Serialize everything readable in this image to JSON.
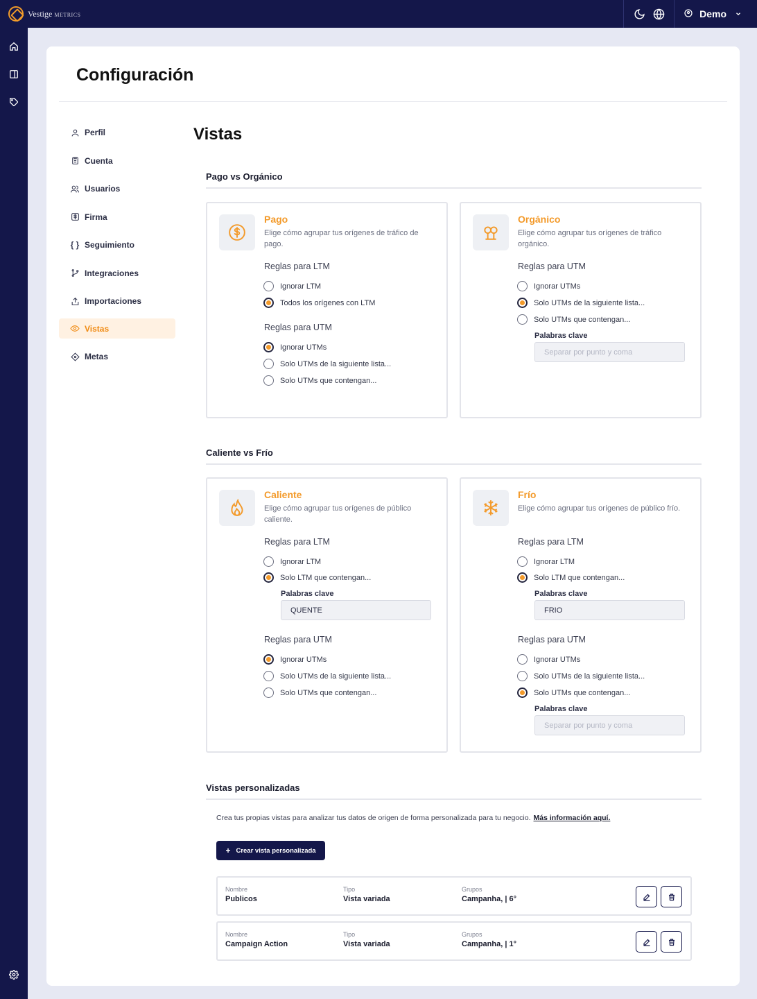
{
  "app": {
    "brand": "Vestige",
    "brand_sub": "Metrics",
    "user": "Demo"
  },
  "page": {
    "title": "Configuración",
    "heading": "Vistas"
  },
  "nav": {
    "items": [
      {
        "label": "Perfil",
        "icon": "user-icon"
      },
      {
        "label": "Cuenta",
        "icon": "clipboard-icon"
      },
      {
        "label": "Usuarios",
        "icon": "users-icon"
      },
      {
        "label": "Firma",
        "icon": "dollar-square-icon"
      },
      {
        "label": "Seguimiento",
        "icon": "braces-icon"
      },
      {
        "label": "Integraciones",
        "icon": "git-branch-icon"
      },
      {
        "label": "Importaciones",
        "icon": "upload-icon"
      },
      {
        "label": "Vistas",
        "icon": "eye-icon",
        "active": true
      },
      {
        "label": "Metas",
        "icon": "diamond-icon"
      }
    ]
  },
  "sections": {
    "paid_organic": "Pago vs Orgánico",
    "hot_cold": "Caliente vs Frío",
    "custom": "Vistas personalizadas"
  },
  "labels": {
    "rules_ltm": "Reglas para LTM",
    "rules_utm": "Reglas para UTM",
    "keywords": "Palabras clave",
    "keywords_placeholder": "Separar por punto y coma"
  },
  "panels": {
    "pago": {
      "title": "Pago",
      "desc": "Elige cómo agrupar tus orígenes de tráfico de pago.",
      "ltm": [
        "Ignorar LTM",
        "Todos los orígenes con LTM"
      ],
      "utm": [
        "Ignorar UTMs",
        "Solo UTMs de la siguiente lista...",
        "Solo UTMs que contengan..."
      ]
    },
    "organico": {
      "title": "Orgánico",
      "desc": "Elige cómo agrupar tus orígenes de tráfico orgánico.",
      "utm": [
        "Ignorar UTMs",
        "Solo UTMs de la siguiente lista...",
        "Solo UTMs que contengan..."
      ]
    },
    "caliente": {
      "title": "Caliente",
      "desc": "Elige cómo agrupar tus orígenes de público caliente.",
      "ltm": [
        "Ignorar LTM",
        "Solo LTM que contengan..."
      ],
      "ltm_keywords": "QUENTE",
      "utm": [
        "Ignorar UTMs",
        "Solo UTMs de la siguiente lista...",
        "Solo UTMs que contengan..."
      ]
    },
    "frio": {
      "title": "Frío",
      "desc": "Elige cómo agrupar tus orígenes de público frío.",
      "ltm": [
        "Ignorar LTM",
        "Solo LTM que contengan..."
      ],
      "ltm_keywords": "FRIO",
      "utm": [
        "Ignorar UTMs",
        "Solo UTMs de la siguiente lista...",
        "Solo UTMs que contengan..."
      ]
    }
  },
  "custom": {
    "intro": "Crea tus propias vistas para analizar tus datos de origen de forma personalizada para tu negocio.",
    "more_link": "Más información aquí.",
    "create_button": "Crear vista personalizada",
    "col_name": "Nombre",
    "col_type": "Tipo",
    "col_groups": "Grupos",
    "rows": [
      {
        "name": "Publicos",
        "type": "Vista variada",
        "groups": "Campanha, | 6°"
      },
      {
        "name": "Campaign Action",
        "type": "Vista variada",
        "groups": "Campanha, | 1°"
      }
    ]
  },
  "colors": {
    "accent": "#f39a2a",
    "navy": "#14174a",
    "background": "#e6e8f3"
  }
}
